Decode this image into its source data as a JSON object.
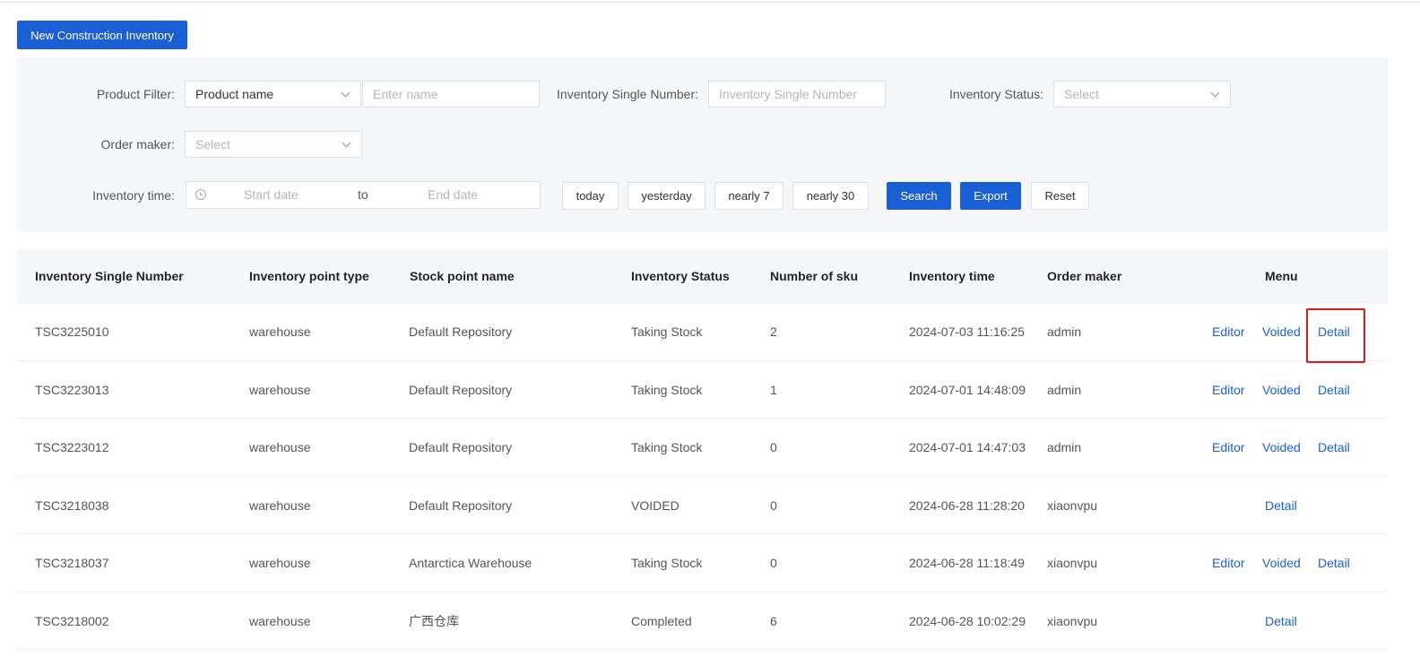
{
  "toolbar": {
    "new_label": "New Construction Inventory"
  },
  "filters": {
    "product_filter_label": "Product Filter:",
    "product_filter_value": "Product name",
    "name_placeholder": "Enter name",
    "single_number_label": "Inventory Single Number:",
    "single_number_placeholder": "Inventory Single Number",
    "status_label": "Inventory Status:",
    "status_placeholder": "Select",
    "order_maker_label": "Order maker:",
    "order_maker_placeholder": "Select",
    "time_label": "Inventory time:",
    "start_placeholder": "Start date",
    "range_sep": "to",
    "end_placeholder": "End date",
    "quick": {
      "today": "today",
      "yesterday": "yesterday",
      "nearly7": "nearly 7",
      "nearly30": "nearly 30"
    },
    "search_label": "Search",
    "export_label": "Export",
    "reset_label": "Reset"
  },
  "table": {
    "headers": {
      "number": "Inventory Single Number",
      "point_type": "Inventory point type",
      "point_name": "Stock point name",
      "status": "Inventory Status",
      "sku": "Number of sku",
      "time": "Inventory time",
      "maker": "Order maker",
      "menu": "Menu"
    },
    "actions": {
      "editor": "Editor",
      "voided": "Voided",
      "detail": "Detail"
    },
    "rows": [
      {
        "number": "TSC3225010",
        "point_type": "warehouse",
        "point_name": "Default Repository",
        "status": "Taking Stock",
        "sku": "2",
        "time": "2024-07-03 11:16:25",
        "maker": "admin"
      },
      {
        "number": "TSC3223013",
        "point_type": "warehouse",
        "point_name": "Default Repository",
        "status": "Taking Stock",
        "sku": "1",
        "time": "2024-07-01 14:48:09",
        "maker": "admin"
      },
      {
        "number": "TSC3223012",
        "point_type": "warehouse",
        "point_name": "Default Repository",
        "status": "Taking Stock",
        "sku": "0",
        "time": "2024-07-01 14:47:03",
        "maker": "admin"
      },
      {
        "number": "TSC3218038",
        "point_type": "warehouse",
        "point_name": "Default Repository",
        "status": "VOIDED",
        "sku": "0",
        "time": "2024-06-28 11:28:20",
        "maker": "xiaonvpu"
      },
      {
        "number": "TSC3218037",
        "point_type": "warehouse",
        "point_name": "Antarctica Warehouse",
        "status": "Taking Stock",
        "sku": "0",
        "time": "2024-06-28 11:18:49",
        "maker": "xiaonvpu"
      },
      {
        "number": "TSC3218002",
        "point_type": "warehouse",
        "point_name": "广西仓库",
        "status": "Completed",
        "sku": "6",
        "time": "2024-06-28 10:02:29",
        "maker": "xiaonvpu"
      }
    ]
  }
}
